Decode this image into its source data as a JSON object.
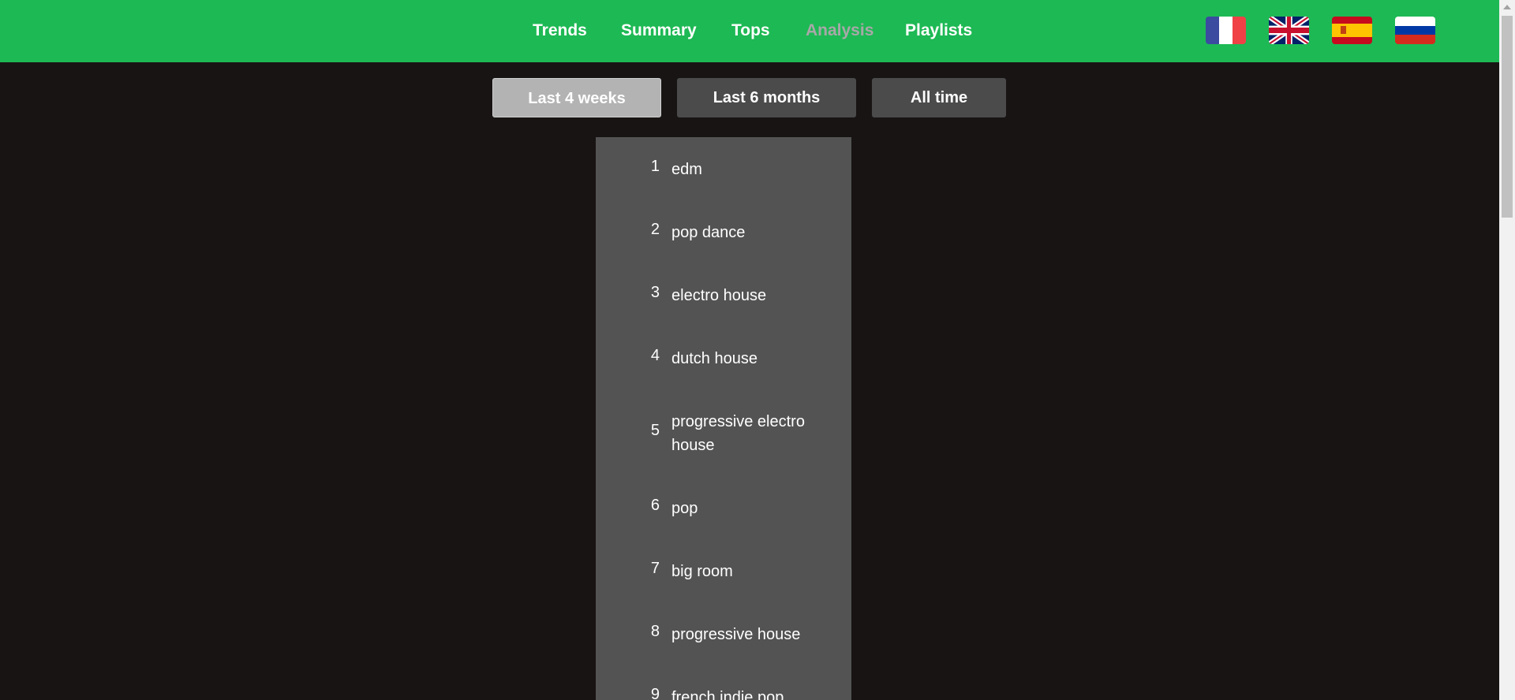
{
  "nav": {
    "links": [
      "Trends",
      "Summary",
      "Tops",
      "Analysis",
      "Playlists"
    ],
    "active_link": "Analysis"
  },
  "languages": [
    {
      "name": "french-flag-icon",
      "colors": [
        "#3b4ba0",
        "#ffffff",
        "#ef4146"
      ]
    },
    {
      "name": "uk-flag-icon",
      "colors": [
        "#012169",
        "#ffffff",
        "#c8102e"
      ]
    },
    {
      "name": "spanish-flag-icon",
      "colors": [
        "#c60b1e",
        "#ffc400"
      ]
    },
    {
      "name": "russian-flag-icon",
      "colors": [
        "#ffffff",
        "#0039a6",
        "#d52b1e"
      ]
    }
  ],
  "time_range": {
    "options": [
      "Last 4 weeks",
      "Last 6 months",
      "All time"
    ],
    "selected": "Last 4 weeks"
  },
  "genres": [
    {
      "rank": "1",
      "name": "edm"
    },
    {
      "rank": "2",
      "name": "pop dance"
    },
    {
      "rank": "3",
      "name": "electro house"
    },
    {
      "rank": "4",
      "name": "dutch house"
    },
    {
      "rank": "5",
      "name": "progressive electro house"
    },
    {
      "rank": "6",
      "name": "pop"
    },
    {
      "rank": "7",
      "name": "big room"
    },
    {
      "rank": "8",
      "name": "progressive house"
    },
    {
      "rank": "9",
      "name": "french indie pop"
    }
  ],
  "colors": {
    "brand_green": "#1db954",
    "background": "#191414",
    "panel": "#535353",
    "button": "#4b4b4b",
    "button_active": "#b3b3b3"
  }
}
